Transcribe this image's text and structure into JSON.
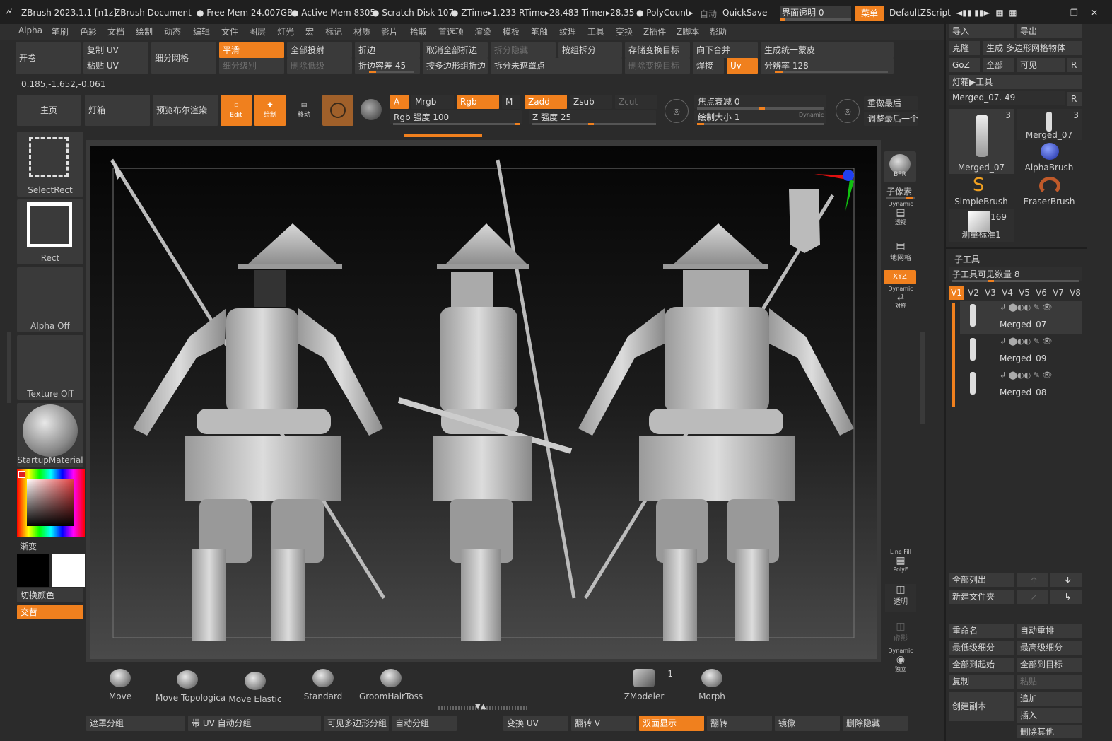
{
  "title_bar": {
    "app": "ZBrush 2023.1.1 [n1z]",
    "document": "ZBrush Document",
    "free_mem": "Free Mem 24.007GB",
    "active_mem": "Active Mem 8305",
    "scratch_disk": "Scratch Disk 107",
    "ztime": "ZTime▸1.233 RTime▸28.483 Timer▸28.35",
    "polycount": "PolyCount▸",
    "auto": "自动",
    "quicksave": "QuickSave",
    "transparency": "界面透明 0",
    "menu": "菜单",
    "script": "DefaultZScript"
  },
  "menus": [
    "Alpha",
    "笔刷",
    "色彩",
    "文档",
    "绘制",
    "动态",
    "编辑",
    "文件",
    "图层",
    "灯光",
    "宏",
    "标记",
    "材质",
    "影片",
    "拾取",
    "首选项",
    "渲染",
    "模板",
    "笔触",
    "纹理",
    "工具",
    "变换",
    "Z插件",
    "Z脚本",
    "帮助"
  ],
  "shelf": {
    "unroll": "开卷",
    "copy_uv": "复制 UV",
    "paste_uv": "粘贴 UV",
    "divide": "细分网格",
    "smooth": "平滑",
    "subdiv_level": "细分级别",
    "project_all": "全部投射",
    "del_lower": "删除低级",
    "crease": "折边",
    "crease_tol": "折边容差 45",
    "uncrease_all": "取消全部折边",
    "crease_pg": "按多边形组折边",
    "split_hidden": "拆分隐藏",
    "split_unmasked": "拆分未遮罩点",
    "group_split": "按组拆分",
    "store_morph": "存储变换目标",
    "del_morph": "删除变换目标",
    "merge_down": "向下合并",
    "weld": "焊接",
    "uv": "Uv",
    "unified_skin": "生成统一蒙皮",
    "resolution": "分辨率 128",
    "coords": "0.185,-1.652,-0.061"
  },
  "toolbar": {
    "home": "主页",
    "lightbox": "灯箱",
    "preview_bool": "预览布尔渲染",
    "edit": "Edit",
    "draw": "绘制",
    "move": "移动",
    "a": "A",
    "mrgb": "Mrgb",
    "rgb": "Rgb",
    "m": "M",
    "zadd": "Zadd",
    "zsub": "Zsub",
    "zcut": "Zcut",
    "rgb_int": "Rgb 强度 100",
    "z_int": "Z 强度 25",
    "focal": "焦点衰减 0",
    "draw_size": "绘制大小 1",
    "dynamic": "Dynamic",
    "redo": "重做最后",
    "adjust_last": "调整最后一个"
  },
  "left": {
    "select_rect": "SelectRect",
    "rect": "Rect",
    "alpha": "Alpha Off",
    "texture": "Texture Off",
    "material": "StartupMaterial",
    "gradient": "渐变",
    "switch_color": "切换颜色",
    "alternate": "交替"
  },
  "right_strip": {
    "bpr": "BPR",
    "subpixel": "子像素",
    "dynamic": "Dynamic",
    "persp": "透视",
    "floor": "地网格",
    "xyz": "XYZ",
    "sym": "对称",
    "linefill": "Line Fill",
    "polyf": "PolyF",
    "transp": "透明",
    "ghost": "虚影",
    "solo": "独立"
  },
  "tool_panel": {
    "import": "导入",
    "export": "导出",
    "clone": "克隆",
    "make_polymesh": "生成 多边形网格物体",
    "goz": "GoZ",
    "all": "全部",
    "visible": "可见",
    "r": "R",
    "lightbox_tool": "灯箱▶工具",
    "current": "Merged_07. 49",
    "thumbs": [
      {
        "name": "Merged_07",
        "count": "3"
      },
      {
        "name": "Merged_07",
        "count": "3"
      },
      {
        "name": "AlphaBrush",
        "count": ""
      },
      {
        "name": "SimpleBrush",
        "count": ""
      },
      {
        "name": "EraserBrush",
        "count": ""
      },
      {
        "name": "测量标准1",
        "count": "169"
      }
    ],
    "subtool": "子工具",
    "visible_count": "子工具可见数量 8",
    "vtabs": [
      "V1",
      "V2",
      "V3",
      "V4",
      "V5",
      "V6",
      "V7",
      "V8"
    ],
    "subtools": [
      "Merged_07",
      "Merged_09",
      "Merged_08"
    ],
    "list_all": "全部列出",
    "new_folder": "新建文件夹",
    "rename": "重命名",
    "auto_reorder": "自动重排",
    "lowest_sub": "最低级细分",
    "highest_sub": "最高级细分",
    "all_low": "全部到起始",
    "all_high": "全部到目标",
    "duplicate": "复制",
    "paste": "粘贴",
    "append": "追加",
    "make_copy": "创建副本",
    "insert": "插入",
    "delete_other": "删除其他"
  },
  "brushes": [
    "Move",
    "Move Topologica",
    "Move Elastic",
    "Standard",
    "GroomHairToss",
    "ZModeler",
    "Morph"
  ],
  "zmodeler_count": "1",
  "bottom": [
    "遮罩分组",
    "带 UV 自动分组",
    "可见多边形分组",
    "自动分组",
    "变换 UV",
    "翻转 V",
    "双面显示",
    "翻转",
    "镜像",
    "删除隐藏"
  ],
  "colors": {
    "accent": "#f0801e",
    "bg": "#2b2b2b",
    "button": "#3a3a3a"
  }
}
